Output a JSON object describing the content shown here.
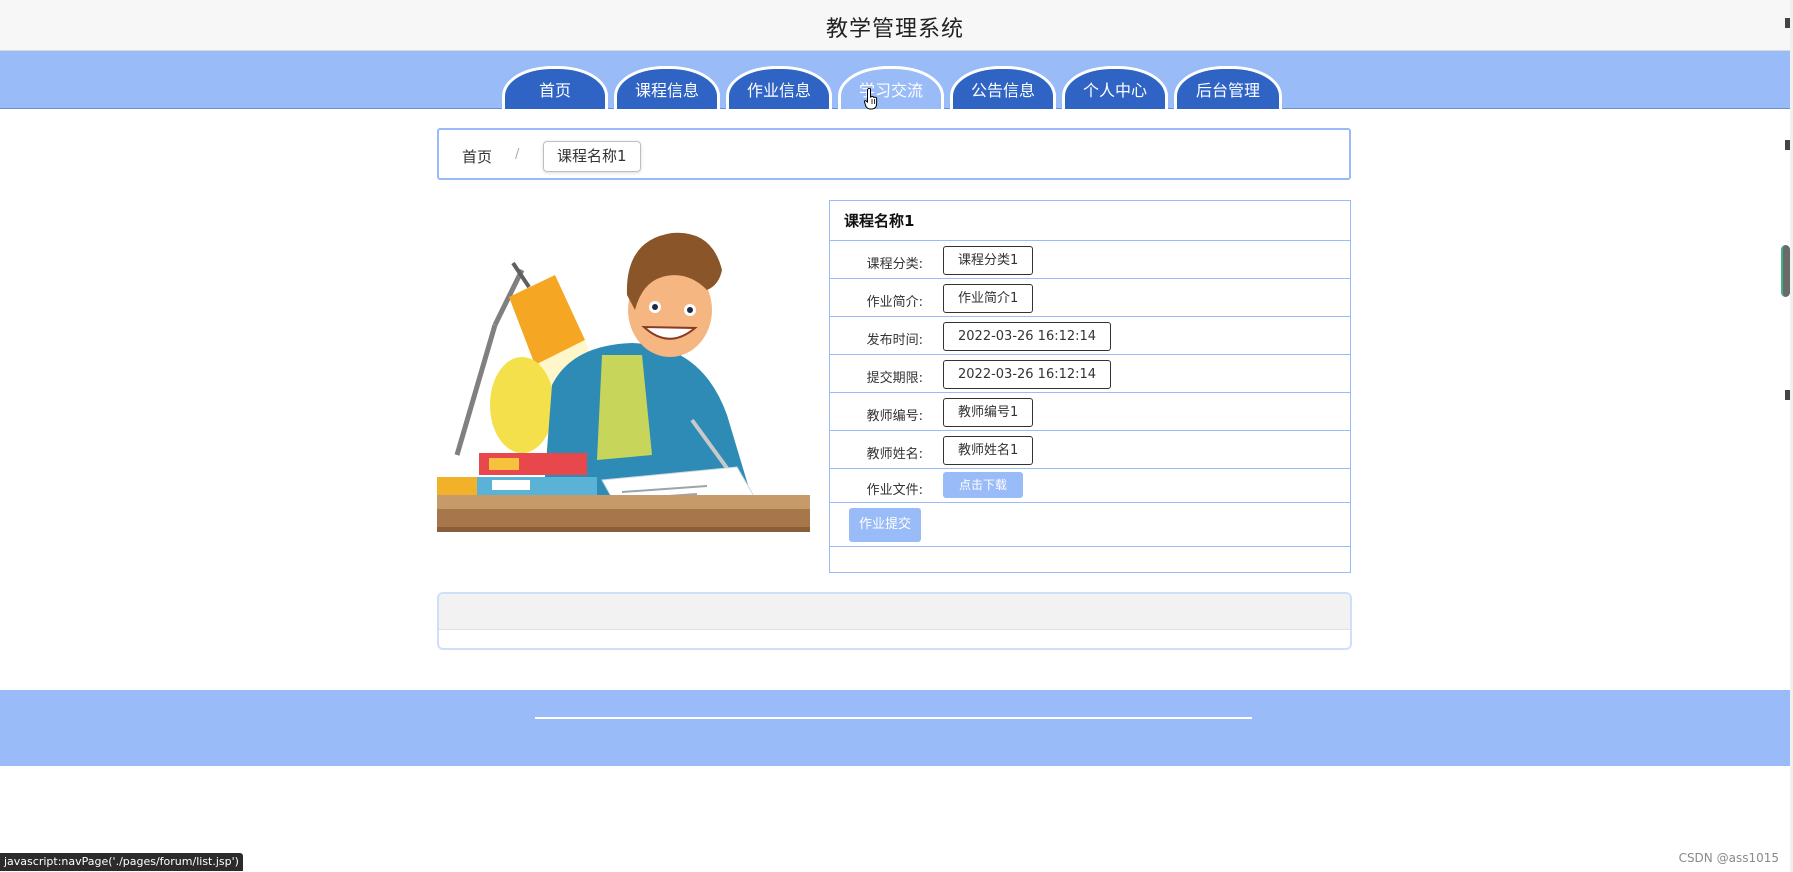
{
  "header": {
    "title": "教学管理系统"
  },
  "nav": {
    "items": [
      {
        "label": "首页"
      },
      {
        "label": "课程信息"
      },
      {
        "label": "作业信息"
      },
      {
        "label": "学习交流"
      },
      {
        "label": "公告信息"
      },
      {
        "label": "个人中心"
      },
      {
        "label": "后台管理"
      }
    ],
    "hovered_index": 3
  },
  "breadcrumb": {
    "home": "首页",
    "separator": "/",
    "current": "课程名称1"
  },
  "detail": {
    "title": "课程名称1",
    "fields": [
      {
        "label": "课程分类:",
        "value": "课程分类1"
      },
      {
        "label": "作业简介:",
        "value": "作业简介1"
      },
      {
        "label": "发布时间:",
        "value": "2022-03-26 16:12:14"
      },
      {
        "label": "提交期限:",
        "value": "2022-03-26 16:12:14"
      },
      {
        "label": "教师编号:",
        "value": "教师编号1"
      },
      {
        "label": "教师姓名:",
        "value": "教师姓名1"
      }
    ],
    "file": {
      "label": "作业文件:",
      "button": "点击下载"
    },
    "submit_button": "作业提交"
  },
  "status_bar": {
    "text": "javascript:navPage('./pages/forum/list.jsp')"
  },
  "watermark": "CSDN @ass1015",
  "colors": {
    "accent": "#99bbf8",
    "nav_tab": "#2f64c4",
    "topbar": "#f7f7f7"
  },
  "icons": {
    "cursor": "hand-pointer-icon"
  }
}
